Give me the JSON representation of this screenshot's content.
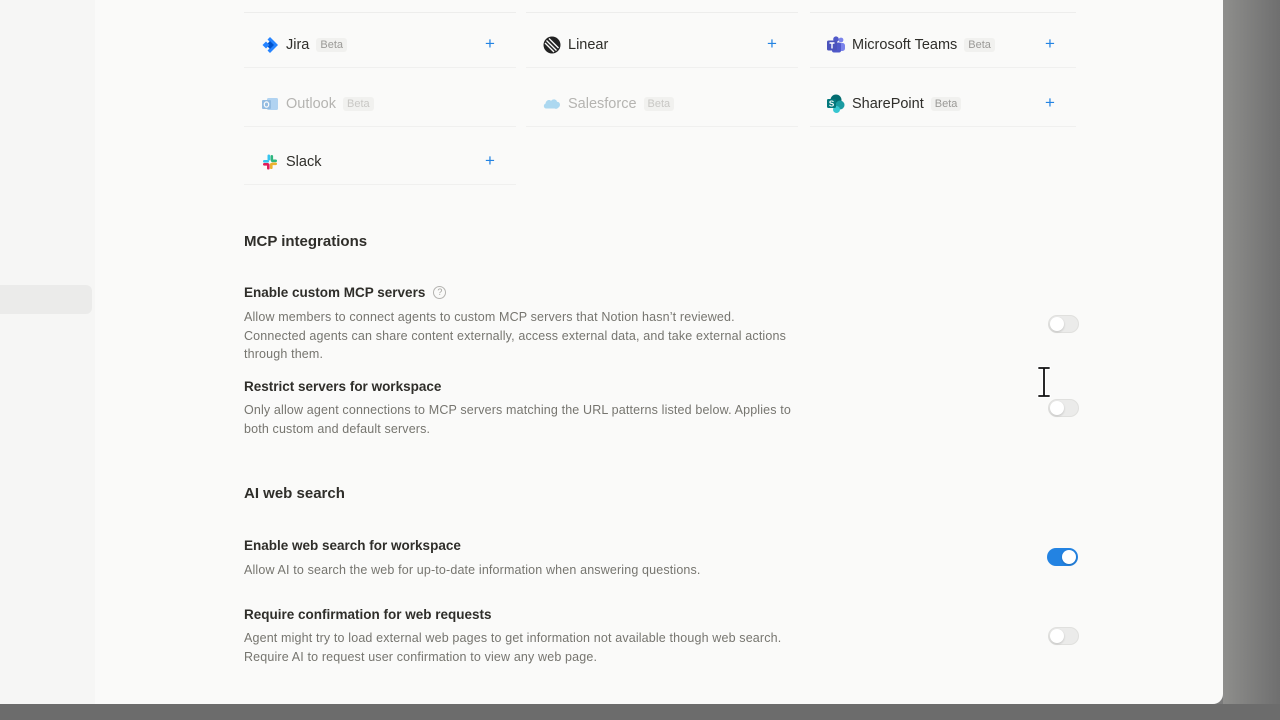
{
  "connectors": [
    {
      "name": "Jira",
      "beta": "Beta",
      "icon": "jira-logo-icon",
      "enabled": true
    },
    {
      "name": "Linear",
      "beta": "",
      "icon": "linear-logo-icon",
      "enabled": true
    },
    {
      "name": "Microsoft Teams",
      "beta": "Beta",
      "icon": "microsoft-teams-logo-icon",
      "enabled": true
    },
    {
      "name": "Outlook",
      "beta": "Beta",
      "icon": "outlook-logo-icon",
      "enabled": false
    },
    {
      "name": "Salesforce",
      "beta": "Beta",
      "icon": "salesforce-logo-icon",
      "enabled": false
    },
    {
      "name": "SharePoint",
      "beta": "Beta",
      "icon": "sharepoint-logo-icon",
      "enabled": true
    },
    {
      "name": "Slack",
      "beta": "",
      "icon": "slack-logo-icon",
      "enabled": true
    }
  ],
  "add_icon": "plus-icon",
  "mcp": {
    "title": "MCP integrations",
    "custom_servers": {
      "title": "Enable custom MCP servers",
      "help": "?",
      "desc_lines": [
        "Allow members to connect agents to custom MCP servers that Notion hasn’t reviewed.",
        "Connected agents can share content externally, access external data, and take external actions",
        "through them."
      ],
      "enabled": false
    },
    "restrict": {
      "title": "Restrict servers for workspace",
      "desc_lines": [
        "Only allow agent connections to MCP servers matching the URL patterns listed below. Applies to",
        "both custom and default servers."
      ],
      "enabled": false
    }
  },
  "web_search": {
    "title": "AI web search",
    "enable": {
      "title": "Enable web search for workspace",
      "desc_lines": [
        "Allow AI to search the web for up-to-date information when answering questions."
      ],
      "enabled": true
    },
    "confirm": {
      "title": "Require confirmation for web requests",
      "desc_lines": [
        "Agent might try to load external web pages to get information not available though web search.",
        "Require AI to request user confirmation to view any web page."
      ],
      "enabled": false
    }
  },
  "colors": {
    "accent": "#2383e2",
    "toggle_off": "#ebebea",
    "text": "#2f2e2a",
    "muted": "#76756f"
  }
}
